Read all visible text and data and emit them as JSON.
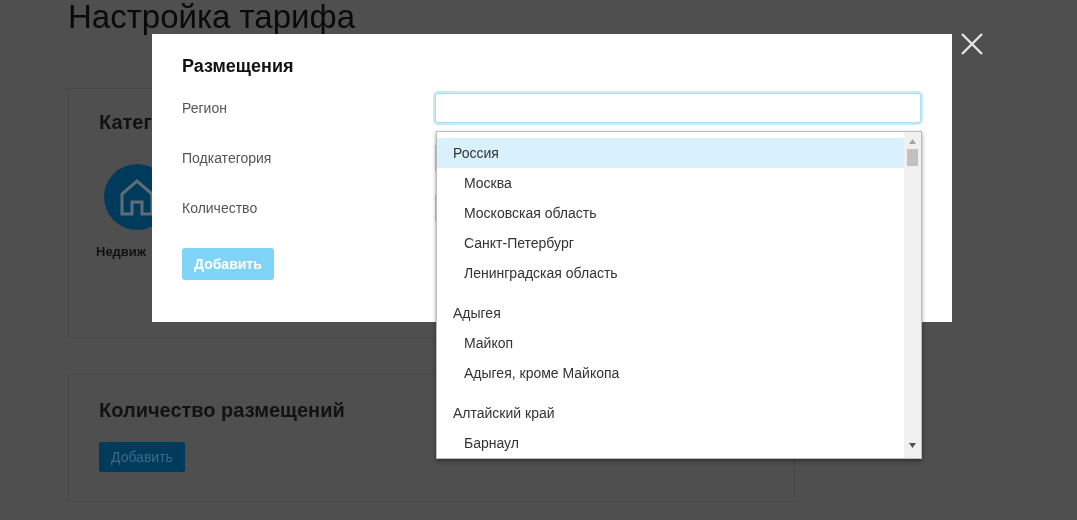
{
  "page_title": "Настройка тарифа",
  "category_card": {
    "title": "Катег",
    "item_label": "Недвиж"
  },
  "count_card": {
    "title": "Количество размещений",
    "button": "Добавить"
  },
  "modal": {
    "title": "Размещения",
    "fields": [
      {
        "label": "Регион",
        "focused": true
      },
      {
        "label": "Подкатегория",
        "focused": false
      },
      {
        "label": "Количество",
        "focused": false
      }
    ],
    "button": {
      "label": "Добавить",
      "disabled": true
    }
  },
  "dropdown": {
    "groups": [
      {
        "label": "Россия",
        "selected": true,
        "children": [
          {
            "label": "Москва",
            "selected": false
          },
          {
            "label": "Московская область",
            "selected": false
          },
          {
            "label": "Санкт-Петербург",
            "selected": false
          },
          {
            "label": "Ленинградская область",
            "selected": false
          }
        ]
      },
      {
        "label": "Адыгея",
        "selected": false,
        "children": [
          {
            "label": "Майкоп",
            "selected": false
          },
          {
            "label": "Адыгея, кроме Майкопа",
            "selected": false
          }
        ]
      },
      {
        "label": "Алтайский край",
        "selected": false,
        "children": [
          {
            "label": "Барнаул",
            "selected": false
          }
        ]
      }
    ]
  }
}
